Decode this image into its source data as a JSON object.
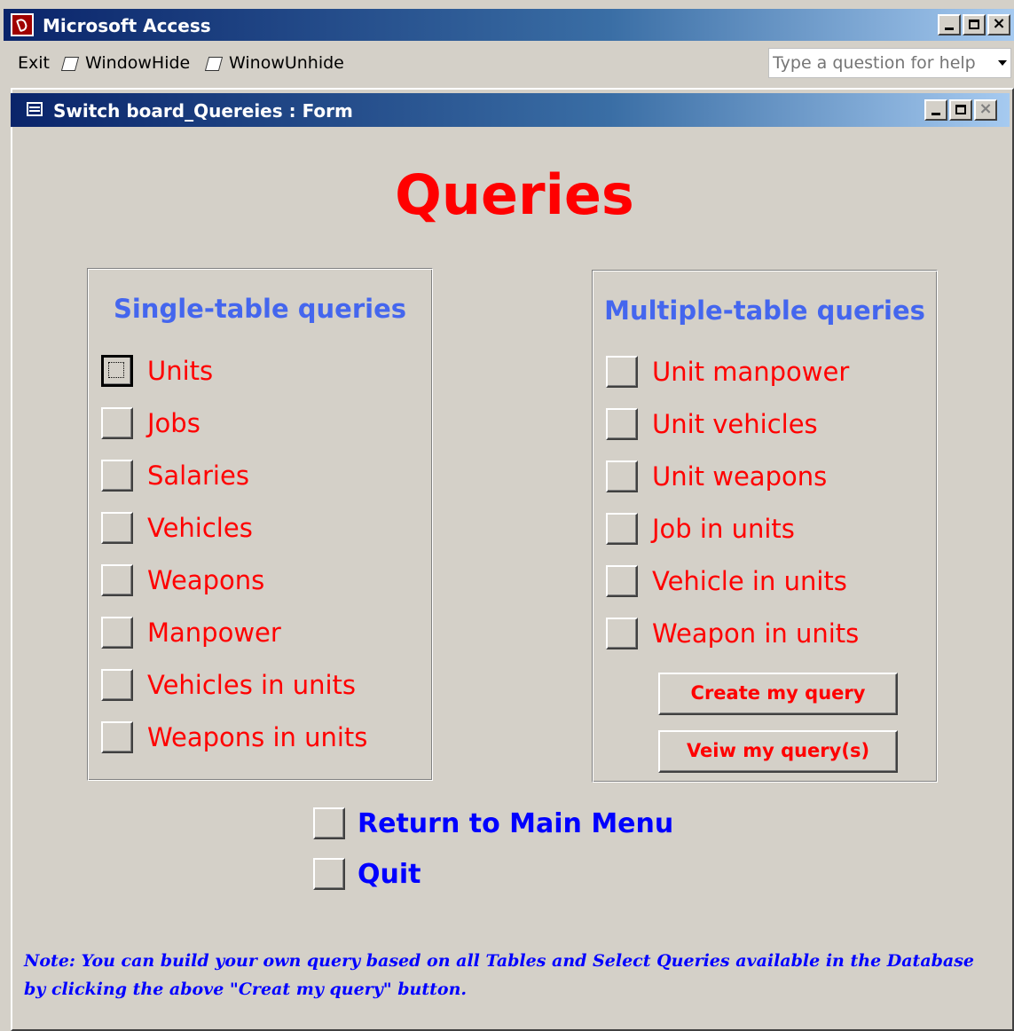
{
  "app": {
    "title": "Microsoft Access",
    "menu": {
      "exit": "Exit",
      "window_hide": "WindowHide",
      "window_unhide": "WinowUnhide"
    },
    "help_placeholder": "Type a question for help"
  },
  "form": {
    "title": "Switch board_Quereies : Form",
    "heading": "Queries",
    "single_group": {
      "title": "Single-table queries",
      "items": [
        "Units",
        "Jobs",
        "Salaries",
        "Vehicles",
        "Weapons",
        "Manpower",
        "Vehicles in units",
        "Weapons in units"
      ]
    },
    "multiple_group": {
      "title": "Multiple-table queries",
      "items": [
        "Unit manpower",
        "Unit vehicles",
        "Unit weapons",
        "Job in units",
        "Vehicle in units",
        "Weapon in units"
      ],
      "create_button": "Create my query",
      "view_button": "Veiw my query(s)"
    },
    "return_label": "Return to Main Menu",
    "quit_label": "Quit",
    "note": "Note:   You can build your own query based on all  Tables and Select Queries available in the Database by clicking the above \"Creat my query\" button."
  },
  "colors": {
    "heading": "#ff0000",
    "group_title": "#4466ee",
    "nav": "#0000ff",
    "titlebar_start": "#0a246a",
    "titlebar_end": "#a6caf0"
  }
}
